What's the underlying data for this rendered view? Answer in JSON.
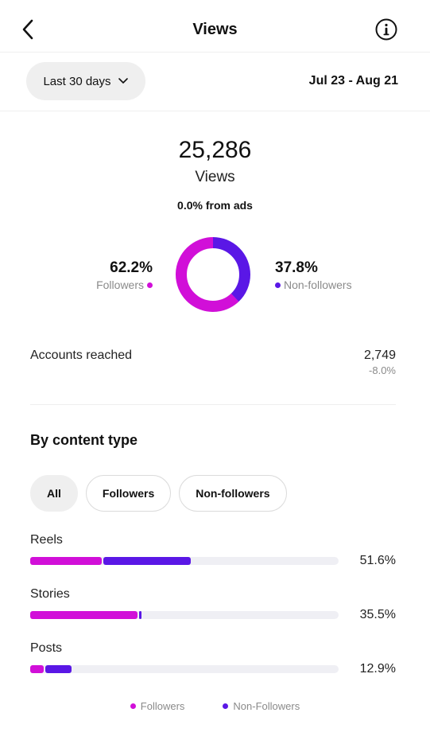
{
  "colors": {
    "followers": "#d10fd8",
    "non_followers": "#5a17e6",
    "track": "#efeff4"
  },
  "header": {
    "title": "Views",
    "back_icon": "chevron-left-icon",
    "info_icon": "info-icon"
  },
  "range": {
    "selected": "Last 30 days",
    "dates": "Jul 23 - Aug 21"
  },
  "summary": {
    "total": "25,286",
    "label": "Views",
    "ads_text": "0.0% from ads",
    "followers_pct": "62.2%",
    "followers_label": "Followers",
    "followers_value": 62.2,
    "non_followers_pct": "37.8%",
    "non_followers_label": "Non-followers",
    "non_followers_value": 37.8
  },
  "reach": {
    "label": "Accounts reached",
    "value": "2,749",
    "change": "-8.0%"
  },
  "content": {
    "title": "By content type",
    "filters": [
      "All",
      "Followers",
      "Non-followers"
    ],
    "active_filter": "All",
    "types": [
      {
        "label": "Reels",
        "pct": "51.6%",
        "followers_share": 23.3,
        "non_followers_share": 28.3
      },
      {
        "label": "Stories",
        "pct": "35.5%",
        "followers_share": 34.7,
        "non_followers_share": 0.8
      },
      {
        "label": "Posts",
        "pct": "12.9%",
        "followers_share": 4.4,
        "non_followers_share": 8.5
      }
    ]
  },
  "legend": {
    "followers": "Followers",
    "non_followers": "Non-Followers"
  }
}
